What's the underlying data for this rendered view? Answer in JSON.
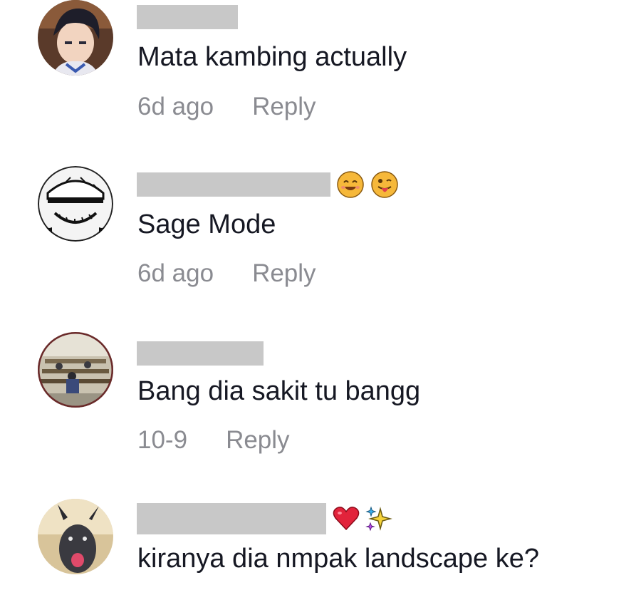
{
  "comments": [
    {
      "avatar": "anime-boy-avatar",
      "name_redacted": true,
      "name_emojis": [],
      "text": "Mata kambing actually",
      "time": "6d ago",
      "reply_label": "Reply"
    },
    {
      "avatar": "manga-face-avatar",
      "name_redacted": true,
      "name_emojis": [
        "smiling-face-icon",
        "winking-tongue-face-icon"
      ],
      "text": "Sage Mode",
      "time": "6d ago",
      "reply_label": "Reply"
    },
    {
      "avatar": "classroom-photo-avatar",
      "name_redacted": true,
      "name_emojis": [],
      "text": "Bang dia sakit tu bangg",
      "time": "10-9",
      "reply_label": "Reply"
    },
    {
      "avatar": "goat-photo-avatar",
      "name_redacted": true,
      "name_emojis": [
        "red-heart-icon",
        "sparkles-icon"
      ],
      "text": "kiranya dia nmpak landscape ke?",
      "time": "",
      "reply_label": ""
    }
  ]
}
